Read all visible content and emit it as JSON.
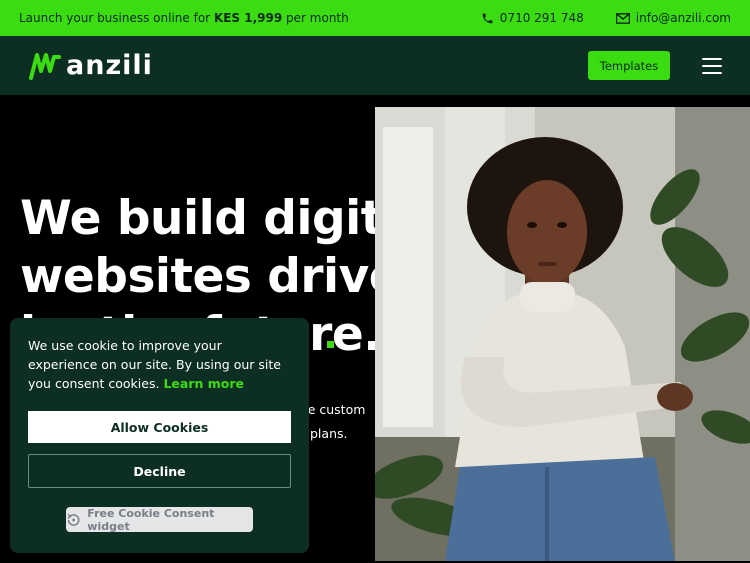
{
  "topbar": {
    "promo_prefix": "Launch your business online for",
    "promo_price": "KES 1,999",
    "promo_suffix": "per month",
    "phone": "0710 291 748",
    "email": "info@anzili.com",
    "phone_icon": "phone-icon",
    "email_icon": "email-icon"
  },
  "nav": {
    "logo_text": "anzili",
    "templates_label": "Templates",
    "menu_icon": "hamburger-icon"
  },
  "hero": {
    "line1": "We build digital",
    "line2": "websites driven",
    "line3": "by the future.",
    "sub1": "ee custom",
    "sub2": "plans."
  },
  "cookie": {
    "message": "We use cookie to improve your experience on our site. By using our site you consent cookies.",
    "learn_more": "Learn more",
    "allow_label": "Allow Cookies",
    "decline_label": "Decline",
    "widget_label": "Free Cookie Consent widget"
  },
  "colors": {
    "accent": "#3bdd12",
    "dark": "#0c2e23"
  }
}
